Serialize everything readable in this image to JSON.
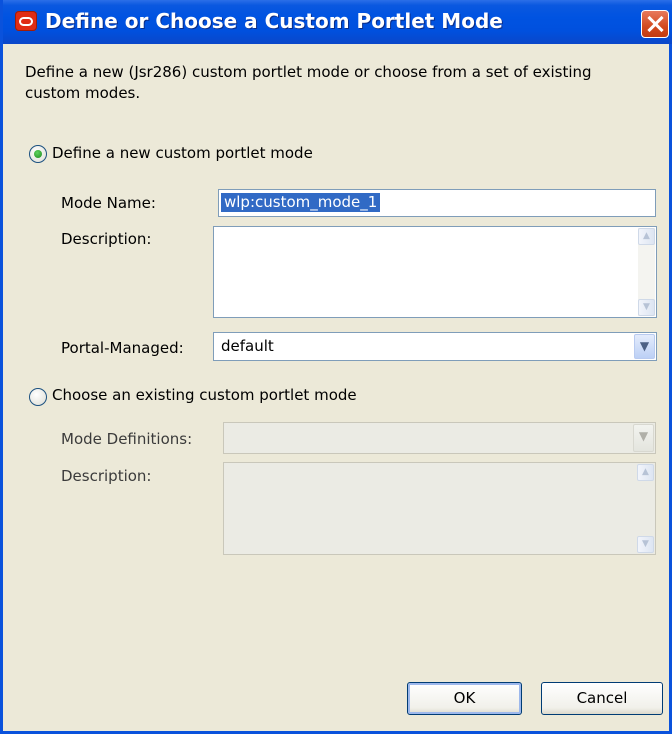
{
  "dialog": {
    "title": "Define or Choose a Custom Portlet Mode",
    "intro": "Define a new (Jsr286) custom portlet mode or choose from a set of existing custom modes."
  },
  "define_section": {
    "radio_label": "Define a new custom portlet mode",
    "selected": true,
    "mode_name_label": "Mode Name:",
    "mode_name_value": "wlp:custom_mode_1",
    "description_label": "Description:",
    "description_value": "",
    "portal_managed_label": "Portal-Managed:",
    "portal_managed_value": "default"
  },
  "choose_section": {
    "radio_label": "Choose an existing custom portlet mode",
    "selected": false,
    "mode_definitions_label": "Mode Definitions:",
    "mode_definitions_value": "",
    "description_label": "Description:",
    "description_value": ""
  },
  "buttons": {
    "ok_label": "OK",
    "cancel_label": "Cancel"
  },
  "icons": {
    "app": "oracle-logo-icon",
    "close": "close-icon",
    "dropdown": "chevron-down-icon",
    "scroll_up": "arrow-up-icon",
    "scroll_down": "arrow-down-icon"
  },
  "colors": {
    "titlebar": "#0053e1",
    "dialog_bg": "#ece9d8",
    "selection": "#316ac5",
    "close_button": "#d24a1f"
  }
}
